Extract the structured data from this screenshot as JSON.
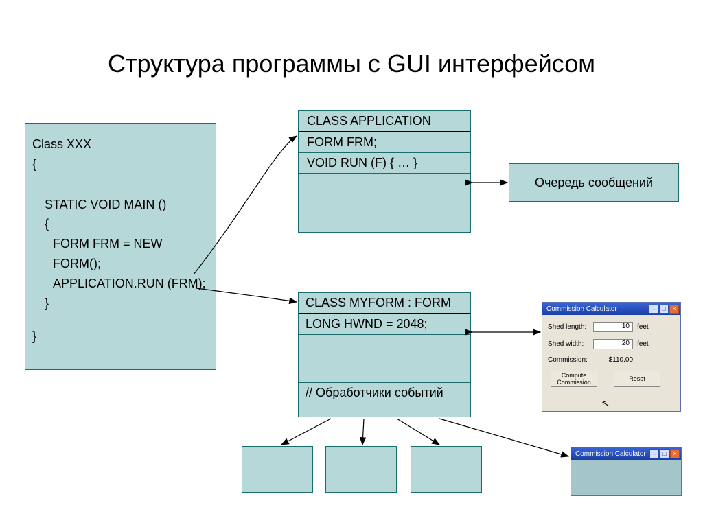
{
  "title": "Структура программы с GUI интерфейсом",
  "xxx": {
    "l1": "Class XXX",
    "l2": "{",
    "l3": "STATIC VOID MAIN ()",
    "l4": "{",
    "l5": "FORM FRM = NEW FORM();",
    "l6": "APPLICATION.RUN (FRM);",
    "l7": "}",
    "l8": "}"
  },
  "app": {
    "head": "CLASS APPLICATION",
    "r1": "FORM FRM;",
    "r2": "VOID RUN (F) { … }"
  },
  "queue": "Очередь сообщений",
  "form": {
    "head": "CLASS MYFORM : FORM",
    "r1": "LONG HWND = 2048;",
    "r2": "// Обработчики событий"
  },
  "calc": {
    "title": "Commission Calculator",
    "f1_label": "Shed length:",
    "f1_value": "10",
    "f1_unit": "feet",
    "f2_label": "Shed width:",
    "f2_value": "20",
    "f2_unit": "feet",
    "f3_label": "Commission:",
    "f3_value": "$110.00",
    "btn1": "Compute Commission",
    "btn2": "Reset"
  },
  "calc2": {
    "title": "Commission Calculator"
  }
}
